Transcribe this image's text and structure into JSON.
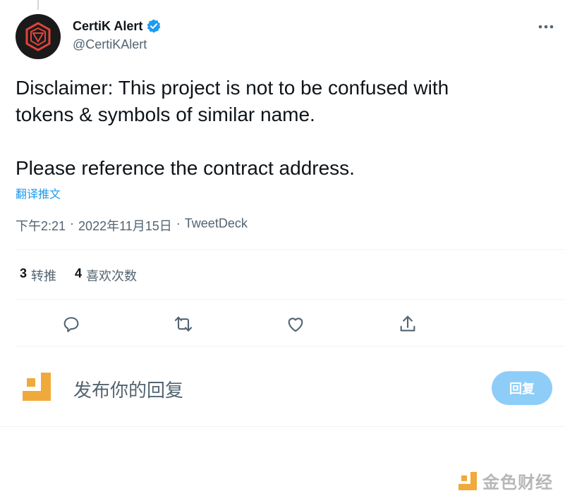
{
  "tweet": {
    "author_name": "CertiK Alert",
    "author_handle": "@CertiKAlert",
    "verified_icon": "verified-badge-icon",
    "text": "Disclaimer: This project is not to be confused with\ntokens & symbols of similar name.\n\nPlease reference the contract address.",
    "translate_label": "翻译推文",
    "time": "下午2:21",
    "date": "2022年11月15日",
    "separator": "·",
    "source": "TweetDeck"
  },
  "stats": [
    {
      "count": "3",
      "label": "转推"
    },
    {
      "count": "4",
      "label": "喜欢次数"
    }
  ],
  "actions": [
    "reply-icon",
    "retweet-icon",
    "like-icon",
    "share-icon"
  ],
  "reply": {
    "placeholder": "发布你的回复",
    "button_label": "回复"
  },
  "watermark": {
    "text": "金色财经"
  },
  "colors": {
    "accent": "#1d9bf0",
    "reply_button": "#8ecdf8",
    "secondary_text": "#536471",
    "brand_orange": "#f0a93b"
  }
}
